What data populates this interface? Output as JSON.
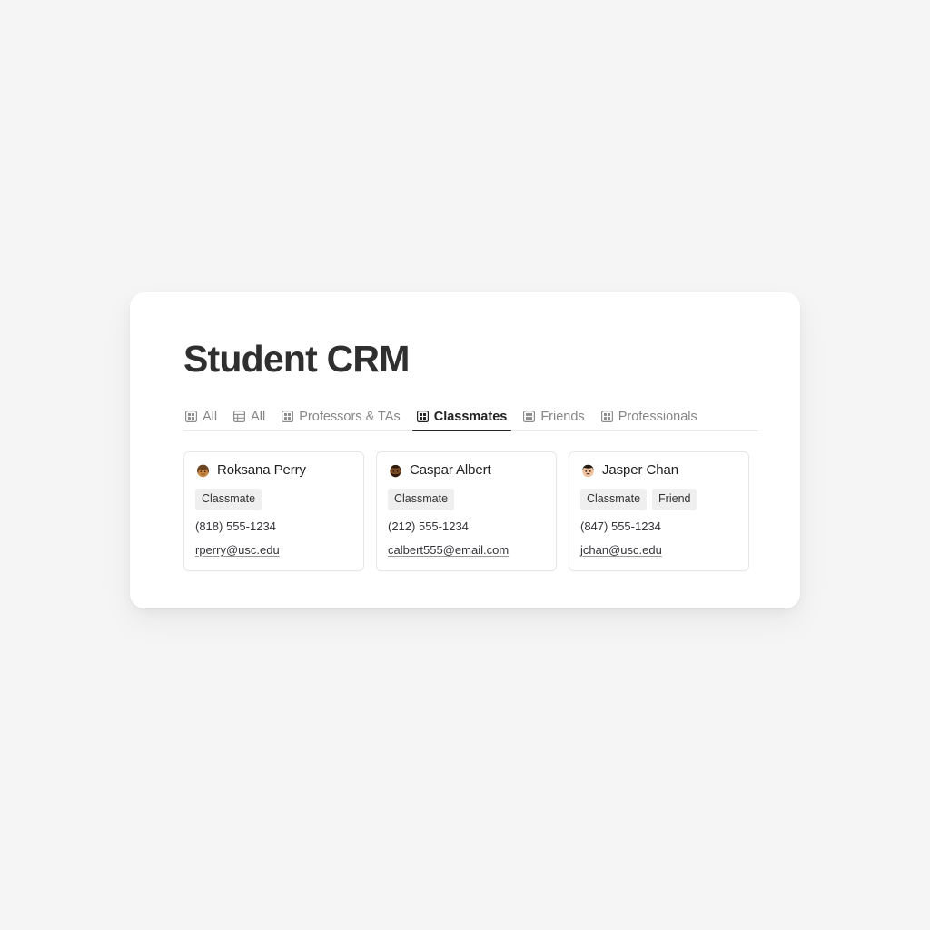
{
  "app": {
    "background_color": "#f5f5f5",
    "panel_color": "#ffffff"
  },
  "header": {
    "title": "Student CRM"
  },
  "tabs": [
    {
      "label": "All",
      "icon": "gallery-grid-icon",
      "active": false
    },
    {
      "label": "All",
      "icon": "table-icon",
      "active": false
    },
    {
      "label": "Professors & TAs",
      "icon": "gallery-grid-icon",
      "active": false
    },
    {
      "label": "Classmates",
      "icon": "gallery-grid-icon",
      "active": true
    },
    {
      "label": "Friends",
      "icon": "gallery-grid-icon",
      "active": false
    },
    {
      "label": "Professionals",
      "icon": "gallery-grid-icon",
      "active": false
    }
  ],
  "cards": [
    {
      "avatar": "woman-emoji",
      "name": "Roksana Perry",
      "tags": [
        "Classmate"
      ],
      "phone": "(818) 555-1234",
      "email": "rperry@usc.edu"
    },
    {
      "avatar": "bearded-man-emoji",
      "name": "Caspar Albert",
      "tags": [
        "Classmate"
      ],
      "phone": "(212) 555-1234",
      "email": "calbert555@email.com"
    },
    {
      "avatar": "man-emoji",
      "name": "Jasper Chan",
      "tags": [
        "Classmate",
        "Friend"
      ],
      "phone": "(847) 555-1234",
      "email": "jchan@usc.edu"
    }
  ],
  "colors": {
    "active_tab": "#222222",
    "inactive_tab": "#868686",
    "tag_background": "#efefef",
    "card_border": "#e6e6e6"
  }
}
